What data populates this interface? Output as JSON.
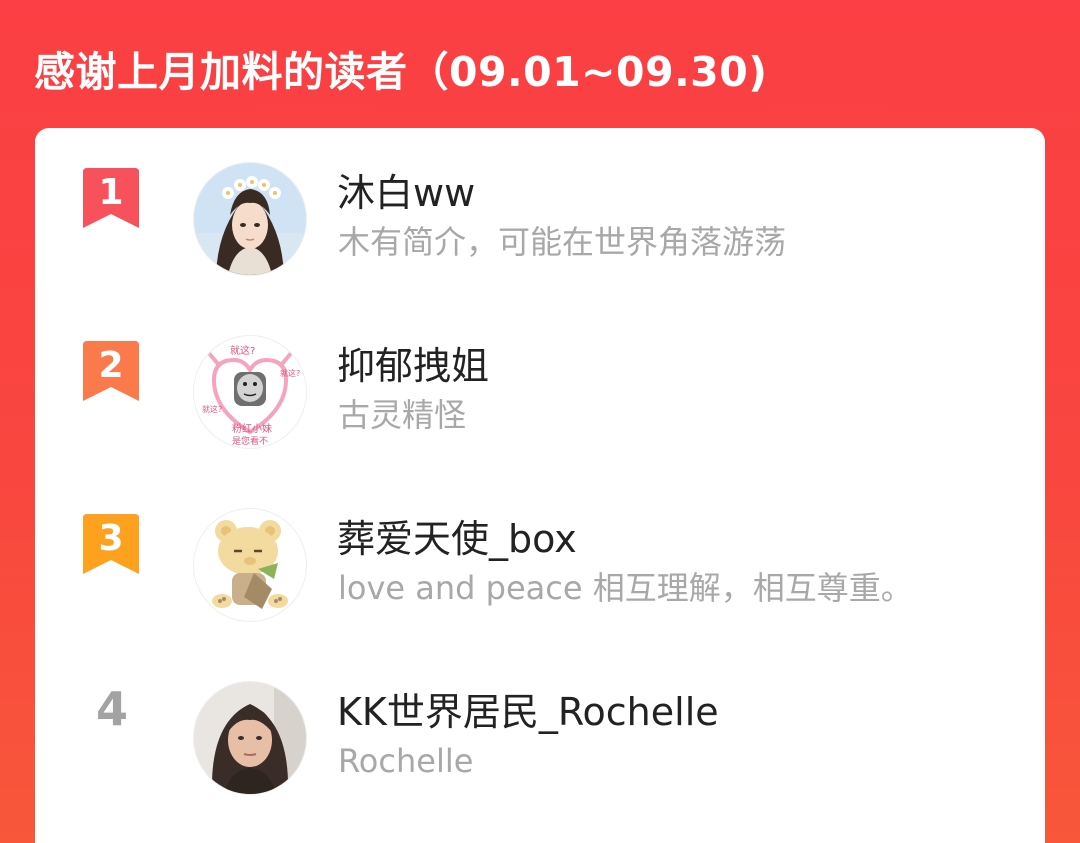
{
  "header": {
    "title": "感谢上月加料的读者（09.01~09.30)"
  },
  "colors": {
    "background": "#fb4142",
    "card": "#ffffff",
    "rank_1": "#f7515b",
    "rank_2": "#fb7a4c",
    "rank_3": "#fda11f",
    "rank_plain": "#a3a3a3",
    "name": "#222222",
    "bio": "#a8a8a8"
  },
  "readers": [
    {
      "rank": "1",
      "name": "沐白ww",
      "bio": "木有简介，可能在世界角落游荡",
      "avatar_icon": "anime-avatar-icon",
      "badge_color": "#f7515b"
    },
    {
      "rank": "2",
      "name": "抑郁拽姐",
      "bio": "古灵精怪",
      "avatar_icon": "meme-avatar-icon",
      "badge_color": "#fb7a4c",
      "avatar_texts": [
        "就这?",
        "就这?",
        "就这?",
        "粉红小妹",
        "是您看不"
      ]
    },
    {
      "rank": "3",
      "name": "葬爱天使_box",
      "bio": "love and peace 相互理解，相互尊重。",
      "avatar_icon": "bear-avatar-icon",
      "badge_color": "#fda11f"
    },
    {
      "rank": "4",
      "name": "KK世界居民_Rochelle",
      "bio": "Rochelle",
      "avatar_icon": "photo-avatar-icon"
    }
  ]
}
